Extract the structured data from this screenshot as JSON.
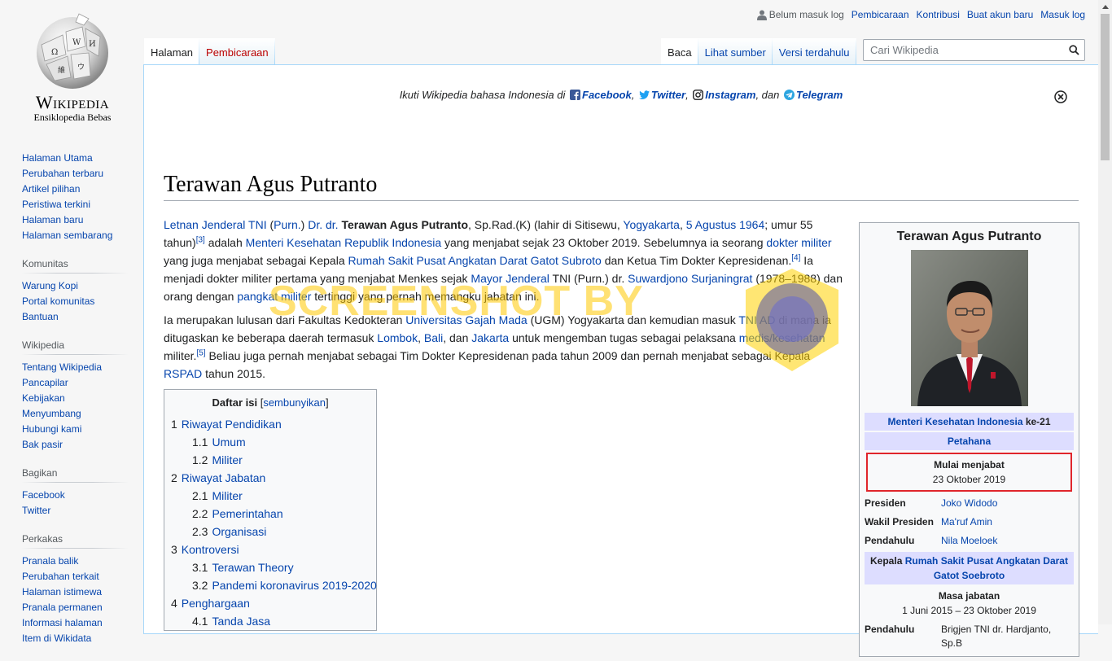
{
  "logo": {
    "wordmark": "Wikipedia",
    "tagline": "Ensiklopedia Bebas"
  },
  "sidebar": {
    "main": [
      "Halaman Utama",
      "Perubahan terbaru",
      "Artikel pilihan",
      "Peristiwa terkini",
      "Halaman baru",
      "Halaman sembarang"
    ],
    "komunitas": {
      "heading": "Komunitas",
      "items": [
        "Warung Kopi",
        "Portal komunitas",
        "Bantuan"
      ]
    },
    "wikipedia": {
      "heading": "Wikipedia",
      "items": [
        "Tentang Wikipedia",
        "Pancapilar",
        "Kebijakan",
        "Menyumbang",
        "Hubungi kami",
        "Bak pasir"
      ]
    },
    "bagikan": {
      "heading": "Bagikan",
      "items": [
        "Facebook",
        "Twitter"
      ]
    },
    "perkakas": {
      "heading": "Perkakas",
      "items": [
        "Pranala balik",
        "Perubahan terkait",
        "Halaman istimewa",
        "Pranala permanen",
        "Informasi halaman",
        "Item di Wikidata"
      ]
    }
  },
  "personal": {
    "not_logged": "Belum masuk log",
    "talk": "Pembicaraan",
    "contrib": "Kontribusi",
    "create": "Buat akun baru",
    "login": "Masuk log"
  },
  "tabs": {
    "page": "Halaman",
    "talk": "Pembicaraan",
    "read": "Baca",
    "source": "Lihat sumber",
    "history": "Versi terdahulu"
  },
  "search": {
    "placeholder": "Cari Wikipedia"
  },
  "banner": {
    "prefix": "Ikuti Wikipedia bahasa Indonesia di",
    "facebook": "Facebook",
    "twitter": "Twitter",
    "instagram": "Instagram",
    "and": ", dan",
    "telegram": "Telegram"
  },
  "article": {
    "title": "Terawan Agus Putranto",
    "p1": {
      "l_letjen": "Letnan Jenderal TNI",
      "l_purn": "Purn.",
      "l_dr": "Dr. dr.",
      "name": "Terawan Agus Putranto",
      "t1": ", Sp.Rad.(K) (lahir di Sitisewu,",
      "l_yogya": "Yogyakarta",
      "l_date": "5 Agustus 1964",
      "t2": "; umur 55 tahun)",
      "ref3": "[3]",
      "t3": " adalah ",
      "l_menkes": "Menteri Kesehatan Republik Indonesia",
      "t4": " yang menjabat sejak 23 Oktober 2019. Sebelumnya ia seorang ",
      "l_dokmil": "dokter militer",
      "t5": " yang juga menjabat sebagai Kepala ",
      "l_rspad": "Rumah Sakit Pusat Angkatan Darat Gatot Subroto",
      "t6": " dan Ketua Tim Dokter Kepresidenan.",
      "ref4": "[4]",
      "t7": " Ia menjadi dokter militer pertama yang menjabat Menkes sejak ",
      "l_mayjen": "Mayor Jenderal",
      "t8": " TNI (Purn.) dr. ",
      "l_suwardjono": "Suwardjono Surjaningrat",
      "t9": " (1978–1988) dan orang dengan ",
      "l_pangkat": "pangkat militer",
      "t10": " tertinggi yang pernah memangku jabatan ini."
    },
    "p2": {
      "t1": "Ia merupakan lulusan dari Fakultas Kedokteran ",
      "l_ugm": "Universitas Gajah Mada",
      "t2": " (UGM) Yogyakarta dan kemudian masuk ",
      "l_tniad": "TNI AD",
      "t3": " di mana ia ditugaskan ke beberapa daerah termasuk ",
      "l_lombok": "Lombok",
      "t4": ", ",
      "l_bali": "Bali",
      "t5": ", dan ",
      "l_jakarta": "Jakarta",
      "t6": " untuk mengemban tugas sebagai pelaksana ",
      "l_medis": "medis/kesehatan",
      "t7": " militer.",
      "ref5": "[5]",
      "t8": " Beliau juga pernah menjabat sebagai Tim Dokter Kepresidenan pada tahun 2009 dan pernah menjabat sebagai Kepala ",
      "l_rspad": "RSPAD",
      "t9": " tahun 2015."
    }
  },
  "toc": {
    "title": "Daftar isi",
    "toggle": "sembunyikan",
    "items": [
      {
        "num": "1",
        "label": "Riwayat Pendidikan",
        "level": 1
      },
      {
        "num": "1.1",
        "label": "Umum",
        "level": 2
      },
      {
        "num": "1.2",
        "label": "Militer",
        "level": 2
      },
      {
        "num": "2",
        "label": "Riwayat Jabatan",
        "level": 1
      },
      {
        "num": "2.1",
        "label": "Militer",
        "level": 2
      },
      {
        "num": "2.2",
        "label": "Pemerintahan",
        "level": 2
      },
      {
        "num": "2.3",
        "label": "Organisasi",
        "level": 2
      },
      {
        "num": "3",
        "label": "Kontroversi",
        "level": 1
      },
      {
        "num": "3.1",
        "label": "Terawan Theory",
        "level": 2
      },
      {
        "num": "3.2",
        "label": "Pandemi koronavirus 2019-2020",
        "level": 2
      },
      {
        "num": "4",
        "label": "Penghargaan",
        "level": 1
      },
      {
        "num": "4.1",
        "label": "Tanda Jasa",
        "level": 2
      }
    ]
  },
  "infobox": {
    "title": "Terawan Agus Putranto",
    "office_link": "Menteri Kesehatan Indonesia",
    "office_suffix": " ke-21",
    "incumbent": "Petahana",
    "since_label": "Mulai menjabat",
    "since_date": "23 Oktober 2019",
    "rows": [
      {
        "k": "Presiden",
        "v": "Joko Widodo"
      },
      {
        "k": "Wakil Presiden",
        "v": "Ma'ruf Amin"
      },
      {
        "k": "Pendahulu",
        "v": "Nila Moeloek"
      }
    ],
    "office2_prefix": "Kepala ",
    "office2_link": "Rumah Sakit Pusat Angkatan Darat Gatot Soebroto",
    "term_label": "Masa jabatan",
    "term_value": "1 Juni 2015 – 23 Oktober 2019",
    "pred2_k": "Pendahulu",
    "pred2_v": "Brigjen TNI dr. Hardjanto, Sp.B"
  },
  "watermark": {
    "text": "SCREENSHOT BY"
  }
}
